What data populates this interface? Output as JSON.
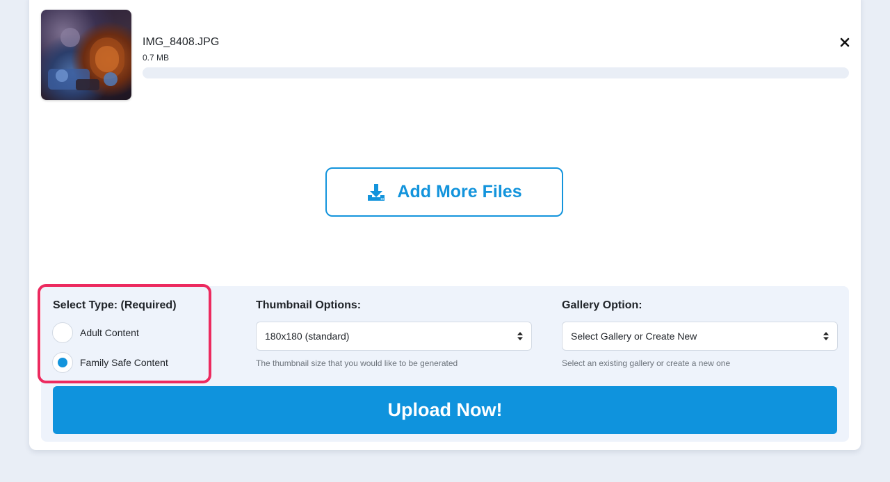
{
  "file": {
    "name": "IMG_8408.JPG",
    "size": "0.7 MB",
    "progress_percent": 0,
    "remove_icon": "close-icon"
  },
  "add_more": {
    "label": "Add More Files",
    "icon": "download-tray-icon"
  },
  "select_type": {
    "label": "Select Type: (Required)",
    "options": [
      {
        "label": "Adult Content",
        "selected": false
      },
      {
        "label": "Family Safe Content",
        "selected": true
      }
    ]
  },
  "thumbnail": {
    "label": "Thumbnail Options:",
    "selected": "180x180 (standard)",
    "help": "The thumbnail size that you would like to be generated"
  },
  "gallery": {
    "label": "Gallery Option:",
    "selected": "Select Gallery or Create New",
    "help": "Select an existing gallery or create a new one"
  },
  "upload": {
    "label": "Upload Now!"
  },
  "colors": {
    "accent": "#1394dc",
    "highlight": "#ec2a5f",
    "panel": "#eef3fb",
    "page": "#e9eef6"
  }
}
